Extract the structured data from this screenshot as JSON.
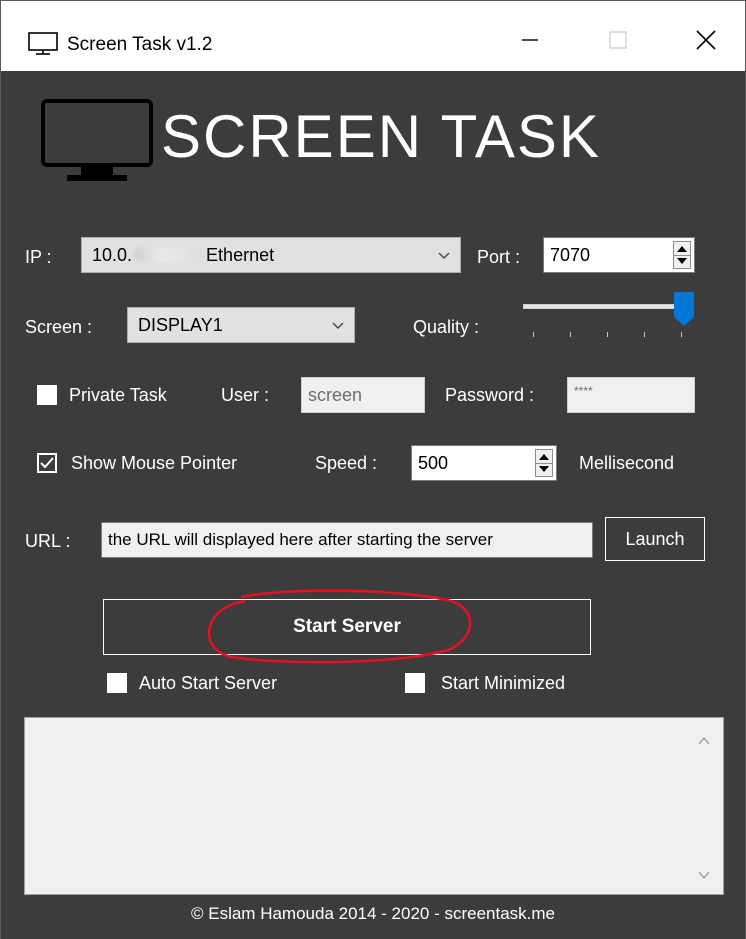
{
  "window": {
    "title": "Screen Task v1.2"
  },
  "logo": {
    "text": "SCREEN TASK"
  },
  "ip": {
    "label": "IP :",
    "value_prefix": "10.0.",
    "value_suffix": "Ethernet"
  },
  "port": {
    "label": "Port :",
    "value": "7070"
  },
  "screen": {
    "label": "Screen :",
    "value": "DISPLAY1"
  },
  "quality": {
    "label": "Quality :",
    "level": 1.0
  },
  "private_task": {
    "label": "Private Task",
    "checked": false
  },
  "user": {
    "label": "User :",
    "value": "screen"
  },
  "password": {
    "label": "Password :",
    "value": "****"
  },
  "show_mouse": {
    "label": "Show Mouse Pointer",
    "checked": true
  },
  "speed": {
    "label": "Speed :",
    "value": "500",
    "unit": "Mellisecond"
  },
  "url": {
    "label": "URL :",
    "value": "the URL will displayed here after starting the server",
    "launch_label": "Launch"
  },
  "start_server": {
    "label": "Start Server"
  },
  "auto_start": {
    "label": "Auto Start Server",
    "checked": false
  },
  "start_minimized": {
    "label": "Start Minimized",
    "checked": false
  },
  "footer": {
    "text": "© Eslam Hamouda 2014 - 2020 - screentask.me"
  },
  "colors": {
    "background": "#3c3c3c",
    "highlight": "#e81123",
    "slider_thumb": "#0078d7"
  }
}
